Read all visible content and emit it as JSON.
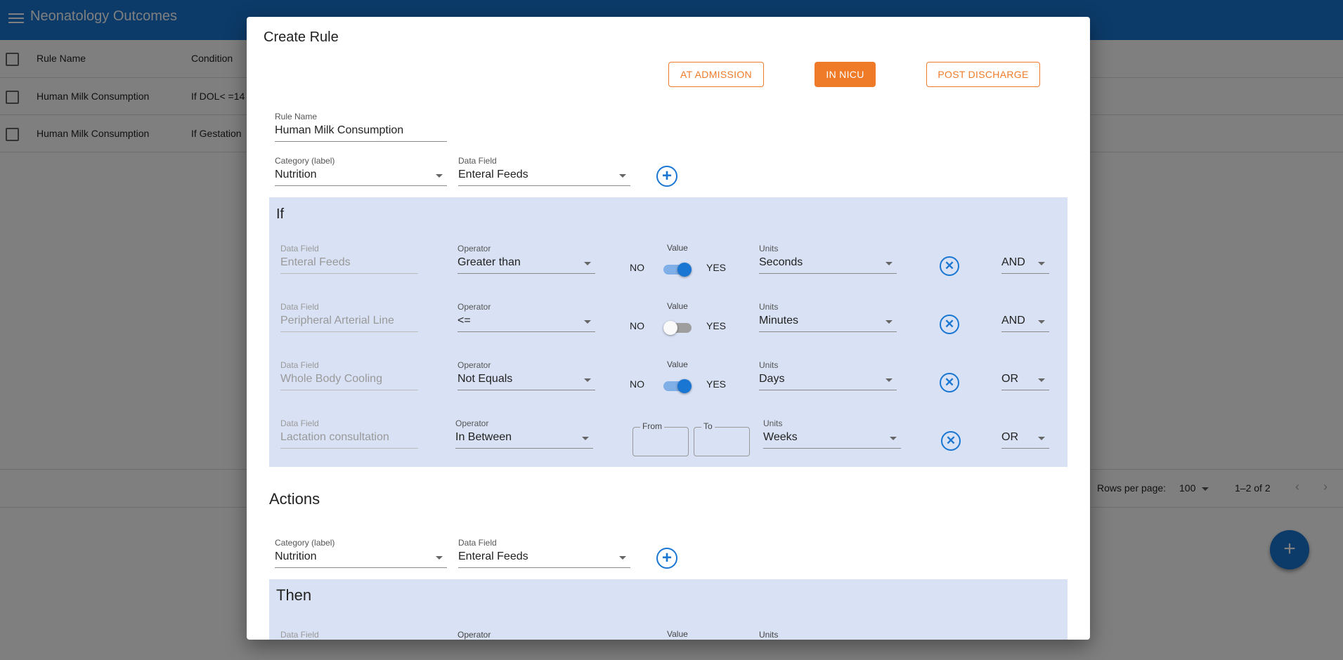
{
  "app": {
    "title": "Neonatology Outcomes"
  },
  "table": {
    "headers": [
      "Rule Name",
      "Condition"
    ],
    "rows": [
      [
        "Human Milk Consumption",
        "If DOL< =14"
      ],
      [
        "Human Milk Consumption",
        "If Gestation"
      ]
    ],
    "footer": {
      "rows_per_page_label": "Rows per page:",
      "rows_per_page": "100",
      "range": "1–2 of 2"
    }
  },
  "dialog": {
    "title": "Create Rule",
    "phase_buttons": [
      "AT ADMISSION",
      "IN NICU",
      "POST DISCHARGE"
    ],
    "active_phase": "IN NICU",
    "rule_name": {
      "label": "Rule Name",
      "value": "Human Milk Consumption"
    },
    "category": {
      "label": "Category (label)",
      "value": "Nutrition"
    },
    "data_field": {
      "label": "Data Field",
      "value": "Enteral Feeds"
    },
    "if_panel": {
      "title": "If",
      "labels": {
        "data_field": "Data Field",
        "operator": "Operator",
        "value": "Value",
        "units": "Units",
        "no": "NO",
        "yes": "YES",
        "from": "From",
        "to": "To"
      },
      "conditions": [
        {
          "data_field": "Enteral Feeds",
          "operator": "Greater than",
          "value_on": true,
          "units": "Seconds",
          "conjunction": "AND"
        },
        {
          "data_field": "Peripheral Arterial Line",
          "operator": "<=",
          "value_on": false,
          "units": "Minutes",
          "conjunction": "AND"
        },
        {
          "data_field": "Whole Body Cooling",
          "operator": "Not Equals",
          "value_on": true,
          "units": "Days",
          "conjunction": "OR"
        },
        {
          "data_field": "Lactation consultation",
          "operator": "In Between",
          "from": "",
          "to": "",
          "units": "Weeks",
          "conjunction": "OR"
        }
      ]
    },
    "actions": {
      "title": "Actions",
      "category": {
        "label": "Category (label)",
        "value": "Nutrition"
      },
      "data_field": {
        "label": "Data Field",
        "value": "Enteral Feeds"
      }
    },
    "then_panel": {
      "title": "Then",
      "labels": {
        "data_field": "Data Field",
        "operator": "Operator",
        "value": "Value",
        "units": "Units"
      }
    }
  },
  "colors": {
    "primary": "#1976d2",
    "accent": "#ef7b29",
    "panel": "#d9e2f4"
  },
  "icons": {
    "menu": "menu-icon",
    "add": "add-circle-icon",
    "remove": "cancel-circle-icon",
    "fab": "plus-icon"
  }
}
